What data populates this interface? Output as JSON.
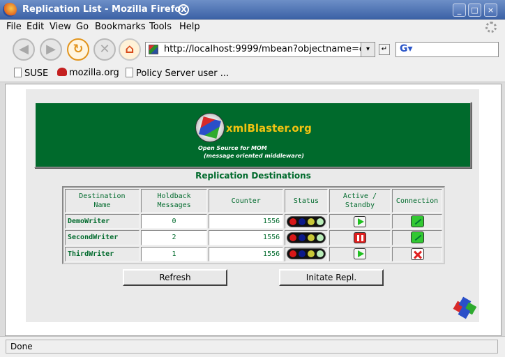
{
  "window": {
    "title": "Replication List - Mozilla Firefox",
    "buttons": [
      "_",
      "□",
      "×"
    ]
  },
  "menu": [
    "File",
    "Edit",
    "View",
    "Go",
    "Bookmarks",
    "Tools",
    "Help"
  ],
  "toolbar": {
    "back": "back-icon",
    "forward": "forward-icon",
    "reload": "reload-icon",
    "stop": "stop-icon",
    "home": "home-icon",
    "url": "http://localhost:9999/mbean?objectname=c",
    "dropdown_glyph": "▾",
    "go_glyph": "↵",
    "search_engine_glyph": "G▾",
    "search_value": ""
  },
  "bookmarks": [
    "SUSE",
    "mozilla.org",
    "Policy Server user ..."
  ],
  "banner": {
    "brand": "xmlBlaster.org",
    "tagline_1": "Open Source for MOM",
    "tagline_2": "(message oriented middleware)"
  },
  "section_title": "Replication Destinations",
  "table": {
    "headers": [
      [
        "Destination",
        "Name"
      ],
      [
        "Holdback",
        "Messages"
      ],
      [
        "Counter"
      ],
      [
        "Status"
      ],
      [
        "Active /",
        "Standby"
      ],
      [
        "Connection"
      ]
    ],
    "rows": [
      {
        "name": "DemoWriter",
        "holdback": "0",
        "counter": "1556",
        "lights": [
          "#d81818",
          "#0c1a8a",
          "#c8c838",
          "#b8ecb8"
        ],
        "active": "play",
        "connection": "on"
      },
      {
        "name": "SecondWriter",
        "holdback": "2",
        "counter": "1556",
        "lights": [
          "#d81818",
          "#0c1a8a",
          "#c8c838",
          "#b8ecb8"
        ],
        "active": "pause",
        "connection": "on"
      },
      {
        "name": "ThirdWriter",
        "holdback": "1",
        "counter": "1556",
        "lights": [
          "#d81818",
          "#0c1a8a",
          "#c8c838",
          "#b8ecb8"
        ],
        "active": "play",
        "connection": "off"
      }
    ]
  },
  "buttons": {
    "refresh": "Refresh",
    "initiate": "Initate Repl."
  },
  "status": "Done",
  "colors": {
    "accent_green": "#006a2c",
    "brand_yellow": "#f2c311"
  }
}
